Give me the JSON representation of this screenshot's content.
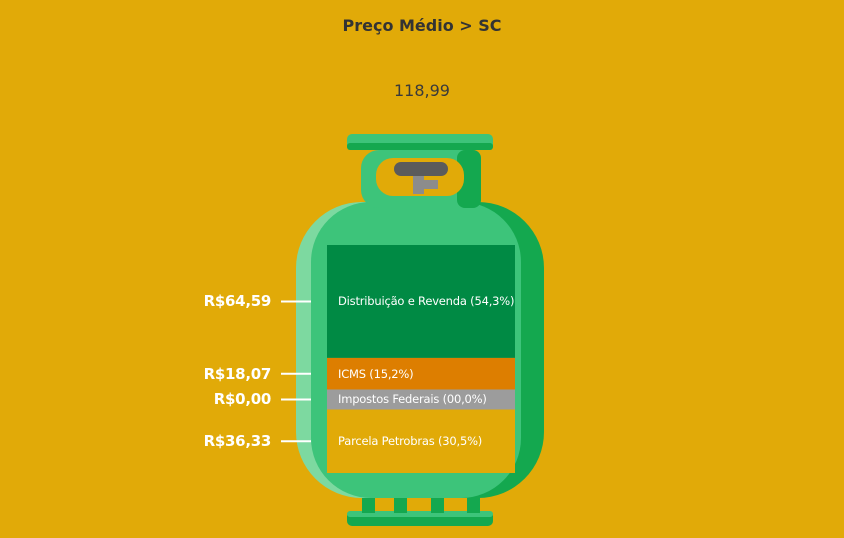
{
  "header": {
    "title": "Preço Médio > SC",
    "total": "118,99"
  },
  "colors": {
    "background": "#E1AA08",
    "cylinder_body": "#3DC47A",
    "cylinder_shadow": "#14A84F",
    "cylinder_highlight": "#7DD9A0",
    "valve": "#5B5B5B"
  },
  "icons": {
    "cylinder": "gas-cylinder-icon",
    "valve": "valve-icon"
  },
  "chart_data": {
    "type": "bar",
    "stacked": true,
    "title": "Preço Médio > SC",
    "total": 118.99,
    "categories": [
      "Distribuição e Revenda (54,3%)",
      "ICMS (15,2%)",
      "Impostos Federais (00,0%)",
      "Parcela Petrobras (30,5%)"
    ],
    "value_labels": [
      "R$64,59",
      "R$18,07",
      "R$0,00",
      "R$36,33"
    ],
    "values": [
      64.59,
      18.07,
      0.0,
      36.33
    ],
    "percent": [
      54.3,
      15.2,
      0.0,
      30.5
    ],
    "colors": [
      "#008A44",
      "#DD7E00",
      "#9C9C9C",
      "#E1AA08"
    ]
  }
}
